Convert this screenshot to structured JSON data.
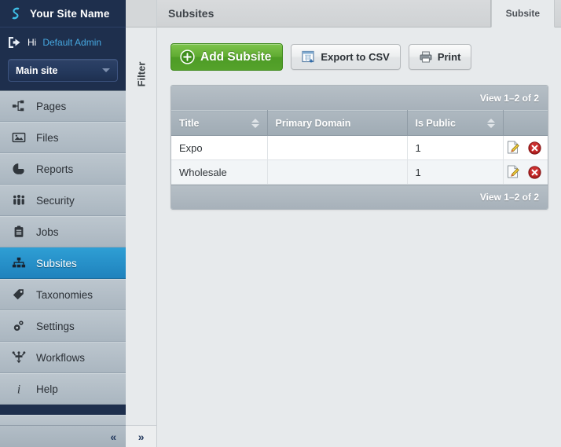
{
  "sidebar": {
    "brand": {
      "logo_icon": "swirl-logo-icon",
      "name": "Your Site Name"
    },
    "user": {
      "logout_icon": "logout-icon",
      "greeting": "Hi",
      "name": "Default Admin"
    },
    "site_select": {
      "value": "Main site",
      "caret_icon": "chevron-down-icon"
    },
    "items": [
      {
        "label": "Pages",
        "icon": "sitemap-icon",
        "active": false
      },
      {
        "label": "Files",
        "icon": "image-icon",
        "active": false
      },
      {
        "label": "Reports",
        "icon": "pie-chart-icon",
        "active": false
      },
      {
        "label": "Security",
        "icon": "people-icon",
        "active": false
      },
      {
        "label": "Jobs",
        "icon": "clipboard-icon",
        "active": false
      },
      {
        "label": "Subsites",
        "icon": "hierarchy-icon",
        "active": true
      },
      {
        "label": "Taxonomies",
        "icon": "tag-icon",
        "active": false
      },
      {
        "label": "Settings",
        "icon": "gears-icon",
        "active": false
      },
      {
        "label": "Workflows",
        "icon": "workflow-icon",
        "active": false
      },
      {
        "label": "Help",
        "icon": "info-icon",
        "active": false
      }
    ],
    "collapse_label": "«"
  },
  "filter_rail": {
    "label": "Filter",
    "expand_label": "»"
  },
  "header": {
    "title": "Subsites",
    "tabs": [
      {
        "label": "Subsite",
        "active": true
      }
    ]
  },
  "toolbar": {
    "add_label": "Add Subsite",
    "add_icon": "plus-circle-icon",
    "export_label": "Export to CSV",
    "export_icon": "spreadsheet-download-icon",
    "print_label": "Print",
    "print_icon": "printer-icon"
  },
  "table": {
    "view_count_top": "View 1–2 of 2",
    "view_count_bottom": "View 1–2 of 2",
    "columns": [
      {
        "label": "Title",
        "sortable": true
      },
      {
        "label": "Primary Domain",
        "sortable": false
      },
      {
        "label": "Is Public",
        "sortable": true
      },
      {
        "label": "",
        "sortable": false
      }
    ],
    "rows": [
      {
        "title": "Expo",
        "primary_domain": "",
        "is_public": "1",
        "edit_icon": "edit-icon",
        "delete_icon": "delete-icon"
      },
      {
        "title": "Wholesale",
        "primary_domain": "",
        "is_public": "1",
        "edit_icon": "edit-icon",
        "delete_icon": "delete-icon"
      }
    ]
  },
  "colors": {
    "sidebar_bg": "#1e2f4d",
    "accent_active": "#2e9ed4",
    "brand_link": "#46a8e0",
    "add_button_green": "#5faa31",
    "delete_red": "#c62828",
    "content_bg": "#e7eaec"
  }
}
